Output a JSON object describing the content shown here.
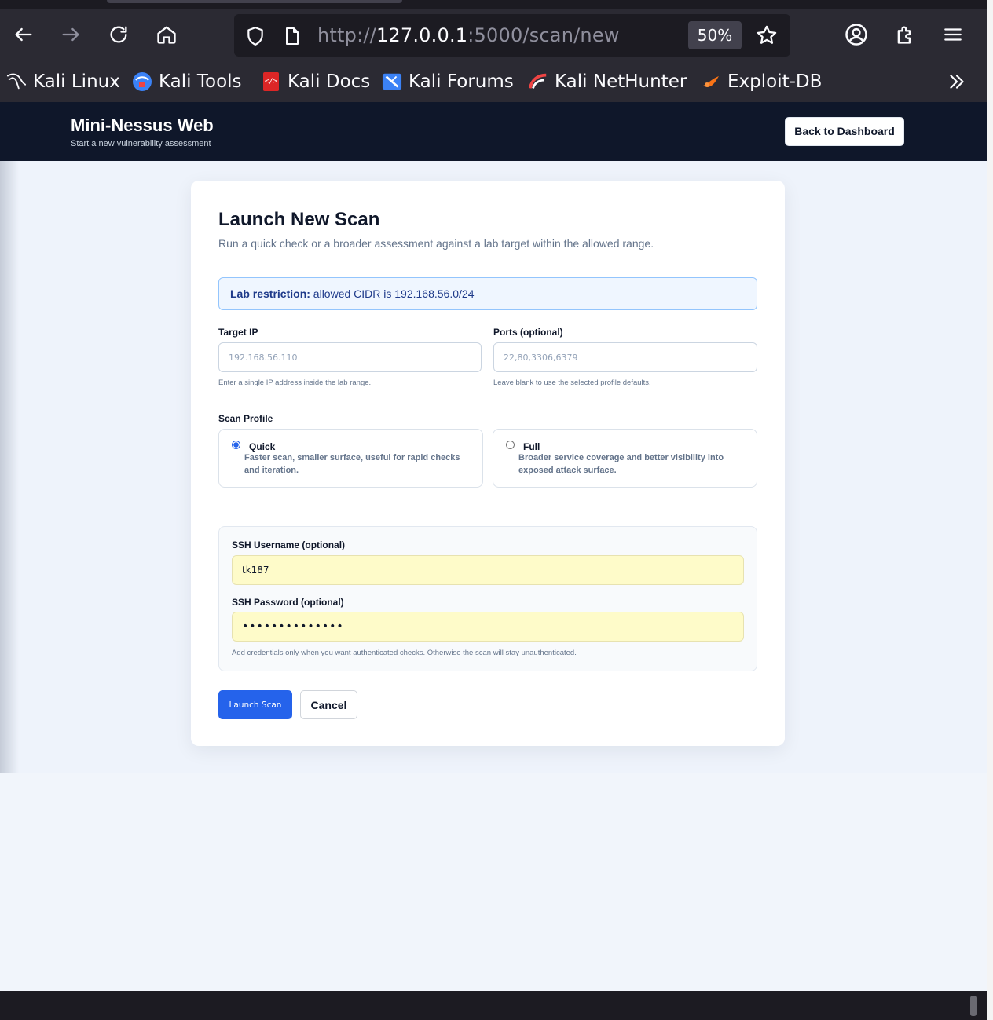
{
  "browser": {
    "url_prefix": "http://",
    "url_host": "127.0.0.1",
    "url_rest": ":5000/scan/new",
    "zoom": "50%",
    "bookmarks": [
      {
        "label": "Kali Linux",
        "icon": "kali-dragon-icon"
      },
      {
        "label": "Kali Tools",
        "icon": "kali-tools-icon"
      },
      {
        "label": "Kali Docs",
        "icon": "kali-docs-icon"
      },
      {
        "label": "Kali Forums",
        "icon": "kali-forums-icon"
      },
      {
        "label": "Kali NetHunter",
        "icon": "kali-nethunter-icon"
      },
      {
        "label": "Exploit-DB",
        "icon": "exploit-db-icon"
      }
    ]
  },
  "header": {
    "title": "Mini-Nessus Web",
    "subtitle": "Start a new vulnerability assessment",
    "back_label": "Back to Dashboard"
  },
  "form": {
    "title": "Launch New Scan",
    "subtitle": "Run a quick check or a broader assessment against a lab target within the allowed range.",
    "notice_label": "Lab restriction:",
    "notice_text": " allowed CIDR is 192.168.56.0/24",
    "target": {
      "label": "Target IP",
      "placeholder": "192.168.56.110",
      "hint": "Enter a single IP address inside the lab range."
    },
    "ports": {
      "label": "Ports (optional)",
      "placeholder": "22,80,3306,6379",
      "hint": "Leave blank to use the selected profile defaults."
    },
    "profile_label": "Scan Profile",
    "profiles": [
      {
        "name": "Quick",
        "description": "Faster scan, smaller surface, useful for rapid checks and iteration.",
        "selected": true
      },
      {
        "name": "Full",
        "description": "Broader service coverage and better visibility into exposed attack surface.",
        "selected": false
      }
    ],
    "ssh": {
      "username_label": "SSH Username (optional)",
      "username_value": "tk187",
      "password_label": "SSH Password (optional)",
      "password_value": "••••••••••••••",
      "hint": "Add credentials only when you want authenticated checks. Otherwise the scan will stay unauthenticated."
    },
    "launch_label": "Launch Scan",
    "cancel_label": "Cancel"
  },
  "colors": {
    "header_bg": "#0f172a",
    "primary": "#2563eb",
    "autofill": "#fefbc9",
    "notice_bg": "#eff6ff"
  }
}
